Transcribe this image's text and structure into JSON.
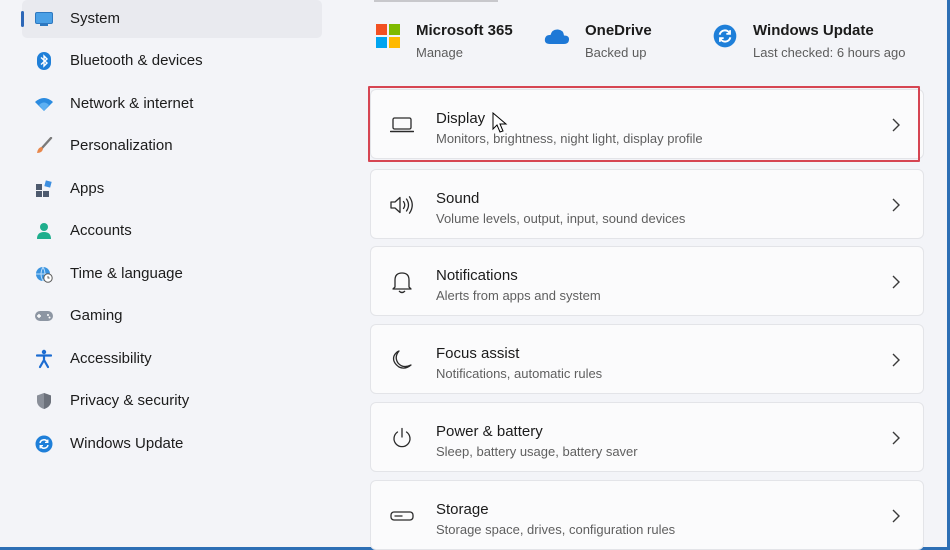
{
  "sidebar": {
    "items": [
      {
        "label": "System",
        "icon": "system-monitor-icon",
        "selected": true
      },
      {
        "label": "Bluetooth & devices",
        "icon": "bluetooth-icon"
      },
      {
        "label": "Network & internet",
        "icon": "wifi-icon"
      },
      {
        "label": "Personalization",
        "icon": "brush-icon"
      },
      {
        "label": "Apps",
        "icon": "apps-icon"
      },
      {
        "label": "Accounts",
        "icon": "person-icon"
      },
      {
        "label": "Time & language",
        "icon": "globe-clock-icon"
      },
      {
        "label": "Gaming",
        "icon": "gamepad-icon"
      },
      {
        "label": "Accessibility",
        "icon": "accessibility-icon"
      },
      {
        "label": "Privacy & security",
        "icon": "shield-icon"
      },
      {
        "label": "Windows Update",
        "icon": "update-icon"
      }
    ]
  },
  "quick": [
    {
      "title": "Microsoft 365",
      "subtitle": "Manage",
      "icon": "microsoft-logo-icon"
    },
    {
      "title": "OneDrive",
      "subtitle": "Backed up",
      "icon": "cloud-icon"
    },
    {
      "title": "Windows Update",
      "subtitle": "Last checked: 6 hours ago",
      "icon": "update-icon"
    }
  ],
  "cards": [
    {
      "title": "Display",
      "subtitle": "Monitors, brightness, night light, display profile",
      "icon": "laptop-icon",
      "highlighted": true
    },
    {
      "title": "Sound",
      "subtitle": "Volume levels, output, input, sound devices",
      "icon": "speaker-icon"
    },
    {
      "title": "Notifications",
      "subtitle": "Alerts from apps and system",
      "icon": "bell-icon"
    },
    {
      "title": "Focus assist",
      "subtitle": "Notifications, automatic rules",
      "icon": "moon-icon"
    },
    {
      "title": "Power & battery",
      "subtitle": "Sleep, battery usage, battery saver",
      "icon": "power-icon"
    },
    {
      "title": "Storage",
      "subtitle": "Storage space, drives, configuration rules",
      "icon": "storage-icon"
    }
  ],
  "colors": {
    "accent": "#2c67b7",
    "highlight": "#d64552",
    "background": "#f3f4f8",
    "card": "#fbfbfc"
  }
}
